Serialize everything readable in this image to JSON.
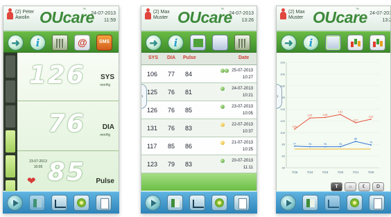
{
  "screens": [
    {
      "user": "(2) Peter Awolin",
      "logo": "OUcare",
      "trademark": "™",
      "date": "24-07-2013",
      "time": "11:59",
      "toolbar": [
        "back-icon",
        "info-icon",
        "trash-icon",
        "email-icon",
        "sms-icon"
      ],
      "sms_label": "SMS",
      "reading": {
        "sys": "126",
        "sys_label": "SYS",
        "sys_unit": "mmHg",
        "dia": "76",
        "dia_label": "DIA",
        "dia_unit": "mmHg",
        "pulse": "85",
        "pulse_label": "Pulse",
        "date": "23-07-2013",
        "time": "10:05"
      }
    },
    {
      "user": "(2) Max Muster",
      "logo": "OUcare",
      "trademark": "™",
      "date": "24-07-2013",
      "time": "13:26",
      "toolbar": [
        "back-icon",
        "info-icon",
        "transfer-icon",
        "edit-icon",
        "trash-icon"
      ],
      "table": {
        "headers": [
          "SYS",
          "DIA",
          "Pulse",
          "Date"
        ],
        "rows": [
          {
            "sys": "106",
            "dia": "77",
            "pulse": "84",
            "date": "25-07-2013",
            "time": "10:27",
            "status": "green",
            "double": true
          },
          {
            "sys": "125",
            "dia": "76",
            "pulse": "81",
            "date": "24-07-2013",
            "time": "10:21",
            "status": "green",
            "double": false
          },
          {
            "sys": "126",
            "dia": "76",
            "pulse": "85",
            "date": "23-07-2013",
            "time": "10:05",
            "status": "green",
            "double": false
          },
          {
            "sys": "131",
            "dia": "76",
            "pulse": "83",
            "date": "22-07-2013",
            "time": "10:37",
            "status": "orange",
            "double": false
          },
          {
            "sys": "117",
            "dia": "85",
            "pulse": "86",
            "date": "21-07-2013",
            "time": "10:25",
            "status": "orange",
            "double": false
          },
          {
            "sys": "123",
            "dia": "79",
            "pulse": "83",
            "date": "20-07-2013",
            "time": "11:11",
            "status": "green",
            "double": false
          }
        ]
      }
    },
    {
      "user": "(2) Max Muster",
      "logo": "OUcare",
      "trademark": "™",
      "date": "24-07-201",
      "time": "13:2",
      "toolbar": [
        "back-icon",
        "info-icon",
        "line-chart-icon",
        "bar-chart-icon",
        "table-icon"
      ],
      "chart_controls": [
        "T",
        "☼",
        "☾",
        "D"
      ],
      "chart_data": {
        "type": "line",
        "x": [
          "7/26",
          "7/24",
          "7/23",
          "7/22",
          "7/21",
          "7/20"
        ],
        "yticks": [
          40,
          60,
          80,
          100,
          120,
          140,
          160,
          180,
          200,
          220
        ],
        "ylim": [
          40,
          220
        ],
        "series": [
          {
            "values": [
              106,
              125,
              126,
              131,
              117,
              123
            ],
            "color": "#e8503c"
          },
          {
            "values": [
              77,
              76,
              76,
              76,
              85,
              79
            ],
            "color": "#2a6fd1"
          },
          {
            "values": [
              72,
              72,
              72,
              72,
              72,
              72
            ],
            "color": "#f0b429"
          }
        ],
        "data_labels": [
          "106",
          "125",
          "126",
          "131",
          "117",
          "123",
          "77",
          "76",
          "76",
          "76",
          "85",
          "79"
        ]
      }
    }
  ]
}
